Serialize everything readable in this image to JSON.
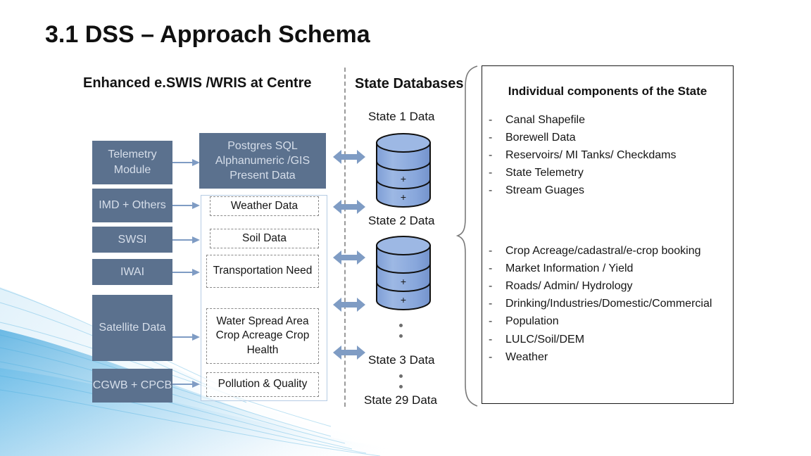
{
  "slide": {
    "title": "3.1 DSS – Approach Schema"
  },
  "colors": {
    "box_fill": "#5B718E",
    "box_text": "#D6DEEA",
    "cylinder_fill": "#8FAADC",
    "arrow_fill": "#7F9CC4",
    "panel_border": "#1A1A1A"
  },
  "centre_column": {
    "heading": "Enhanced e.SWIS /WRIS at Centre",
    "sources": [
      {
        "label": "Telemetry Module"
      },
      {
        "label": "IMD + Others"
      },
      {
        "label": "SWSI"
      },
      {
        "label": "IWAI"
      },
      {
        "label": "Satellite Data"
      },
      {
        "label": "CGWB + CPCB"
      }
    ],
    "postgres_box": "Postgres SQL Alphanumeric /GIS Present Data",
    "derived": [
      {
        "label": "Weather Data"
      },
      {
        "label": "Soil Data"
      },
      {
        "label": "Transportation Need"
      },
      {
        "label": "Water Spread Area Crop Acreage Crop Health"
      },
      {
        "label": "Pollution & Quality"
      }
    ]
  },
  "state_column": {
    "heading": "State Databases",
    "labels": [
      {
        "label": "State 1 Data"
      },
      {
        "label": "State 2 Data"
      },
      {
        "label": "State 3 Data"
      },
      {
        "label": "State 29 Data"
      }
    ],
    "cylinder_plus": "+"
  },
  "state_components": {
    "title": "Individual components of the State",
    "bullet": "-",
    "group_1": [
      "Canal Shapefile",
      "Borewell Data",
      "Reservoirs/ MI Tanks/ Checkdams",
      "State Telemetry",
      "Stream Guages"
    ],
    "group_2": [
      "Crop Acreage/cadastral/e-crop booking",
      "Market Information / Yield",
      "Roads/ Admin/ Hydrology",
      "Drinking/Industries/Domestic/Commercial",
      "Population",
      "LULC/Soil/DEM",
      "Weather"
    ]
  }
}
